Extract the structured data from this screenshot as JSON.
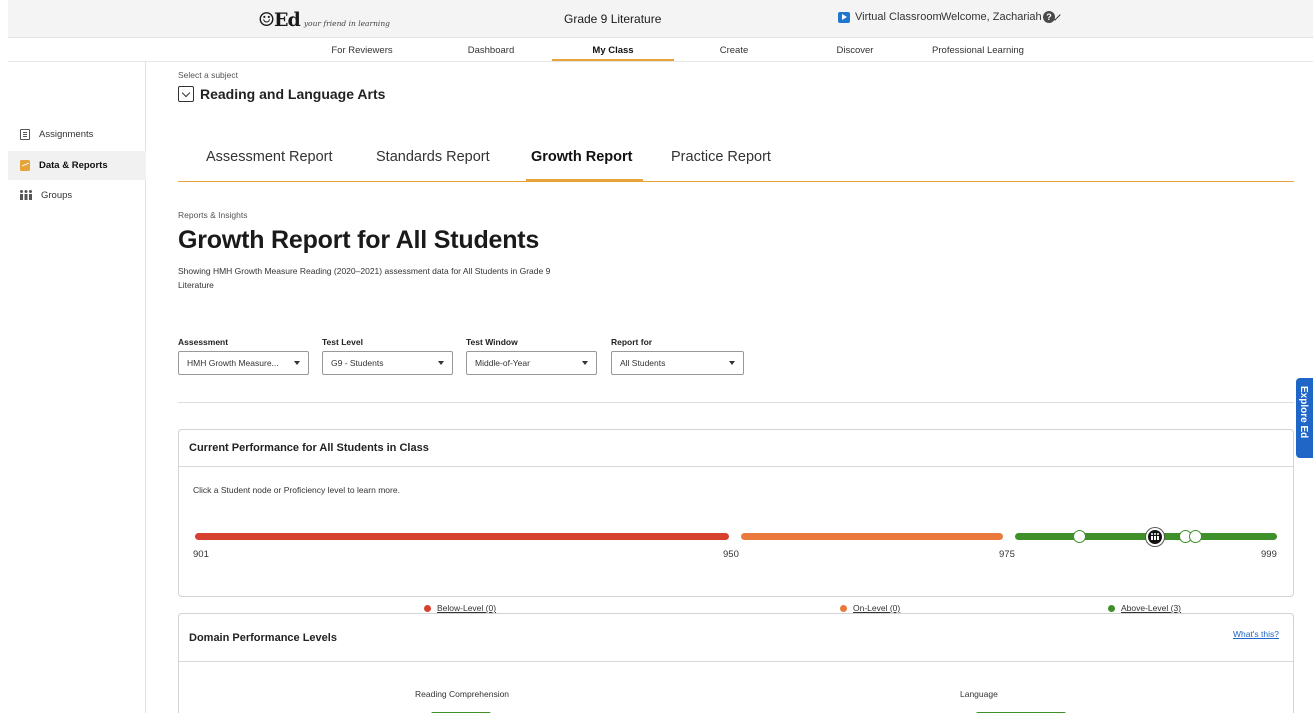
{
  "header": {
    "logo_mark": "☺Ed",
    "logo_tagline": "your friend in learning",
    "class_title": "Grade 9 Literature",
    "virtual_classroom": "Virtual Classroom",
    "welcome": "Welcome, Zachariah",
    "help": "?"
  },
  "nav": {
    "items": [
      "For Reviewers",
      "Dashboard",
      "My Class",
      "Create",
      "Discover",
      "Professional Learning"
    ],
    "active": "My Class",
    "accent": "#e6a33a"
  },
  "sidebar": {
    "items": [
      {
        "label": "Assignments",
        "icon": "clipboard-icon"
      },
      {
        "label": "Data & Reports",
        "icon": "chart-icon"
      },
      {
        "label": "Groups",
        "icon": "groups-icon"
      }
    ],
    "active": "Data & Reports"
  },
  "subject": {
    "label": "Select a subject",
    "value": "Reading and Language Arts"
  },
  "report_tabs": {
    "items": [
      "Assessment Report",
      "Standards Report",
      "Growth Report",
      "Practice Report"
    ],
    "active": "Growth Report"
  },
  "page": {
    "section_label": "Reports & Insights",
    "title": "Growth Report for All Students",
    "description": "Showing HMH Growth Measure Reading (2020–2021) assessment data for All Students in Grade 9 Literature"
  },
  "filters": [
    {
      "label": "Assessment",
      "value": "HMH Growth Measure..."
    },
    {
      "label": "Test Level",
      "value": "G9 - Students"
    },
    {
      "label": "Test Window",
      "value": "Middle-of-Year"
    },
    {
      "label": "Report for",
      "value": "All Students"
    }
  ],
  "performance": {
    "title": "Current Performance for All Students in Class",
    "hint": "Click a Student node or Proficiency level to learn more.",
    "scale": [
      "901",
      "950",
      "975",
      "999"
    ],
    "levels": [
      {
        "label": "Below-Level (0)",
        "color": "#d6412f"
      },
      {
        "label": "On-Level (0)",
        "color": "#ea7a3b"
      },
      {
        "label": "Above-Level (3)",
        "color": "#3f8f2a"
      }
    ]
  },
  "domain": {
    "title": "Domain Performance Levels",
    "whats_this": "What's this?",
    "domains": [
      "Reading Comprehension",
      "Language"
    ]
  },
  "explore_tab": "Explore Ed"
}
